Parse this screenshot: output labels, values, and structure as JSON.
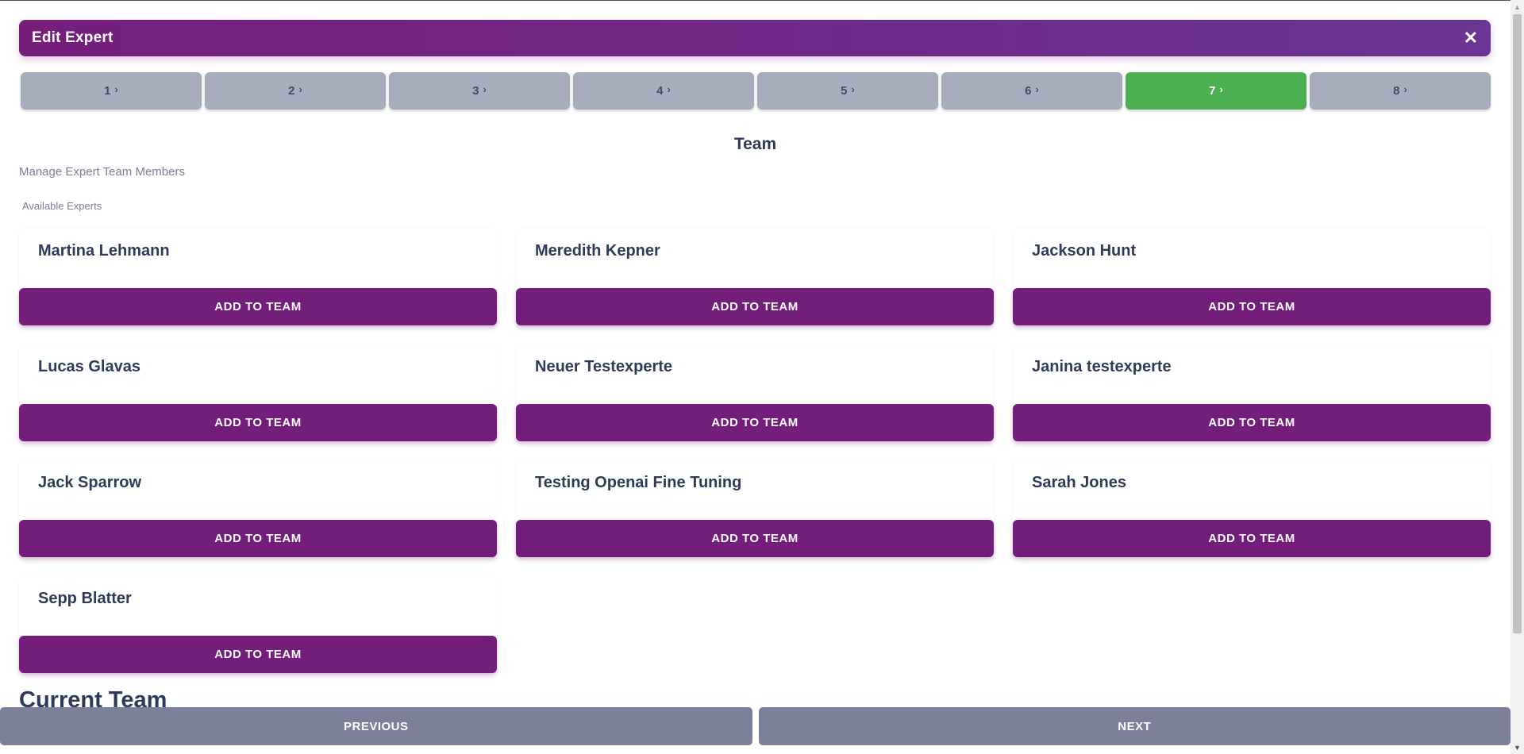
{
  "header": {
    "title": "Edit Expert",
    "close_glyph": "✕"
  },
  "steps": [
    {
      "label": "1",
      "active": false
    },
    {
      "label": "2",
      "active": false
    },
    {
      "label": "3",
      "active": false
    },
    {
      "label": "4",
      "active": false
    },
    {
      "label": "5",
      "active": false
    },
    {
      "label": "6",
      "active": false
    },
    {
      "label": "7",
      "active": true
    },
    {
      "label": "8",
      "active": false
    }
  ],
  "step_chevron": "›",
  "section": {
    "title": "Team",
    "subtitle": "Manage Expert Team Members",
    "available_label": "Available Experts"
  },
  "experts": [
    {
      "name": "Martina Lehmann"
    },
    {
      "name": "Meredith Kepner"
    },
    {
      "name": "Jackson Hunt"
    },
    {
      "name": "Lucas Glavas"
    },
    {
      "name": "Neuer Testexperte"
    },
    {
      "name": "Janina testexperte"
    },
    {
      "name": "Jack Sparrow"
    },
    {
      "name": "Testing Openai Fine Tuning"
    },
    {
      "name": "Sarah Jones"
    },
    {
      "name": "Sepp Blatter"
    }
  ],
  "add_button_label": "ADD TO TEAM",
  "current_team_title": "Current Team",
  "footer": {
    "previous_label": "PREVIOUS",
    "next_label": "NEXT"
  },
  "colors": {
    "brand_purple": "#741e7b",
    "active_step": "#4caf50",
    "inactive_step": "#a8adbd",
    "nav_button": "#7d8099"
  }
}
